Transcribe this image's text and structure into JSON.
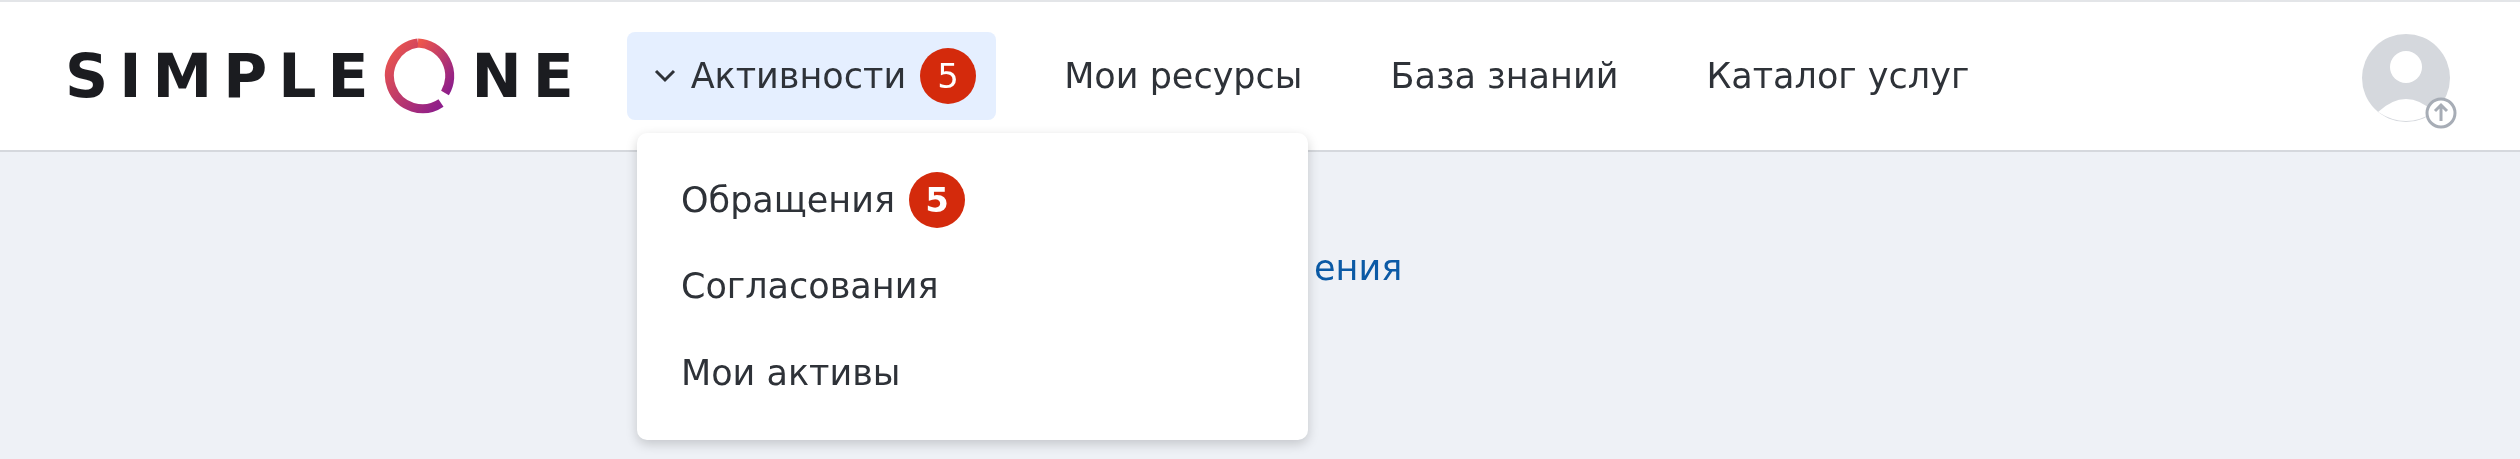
{
  "header": {
    "logo": {
      "before": "SIMPLE",
      "after": "NE"
    },
    "nav": [
      {
        "label": "Активности",
        "badge": "5",
        "expanded": true,
        "kind": "dropdown"
      },
      {
        "label": "Мои ресурсы",
        "kind": "link"
      },
      {
        "label": "База знаний",
        "kind": "link"
      },
      {
        "label": "Каталог услуг",
        "kind": "link"
      }
    ]
  },
  "dropdown": {
    "items": [
      {
        "label": "Обращения",
        "badge": "5"
      },
      {
        "label": "Согласования"
      },
      {
        "label": "Мои активы"
      }
    ]
  },
  "page": {
    "link": "ения"
  }
}
